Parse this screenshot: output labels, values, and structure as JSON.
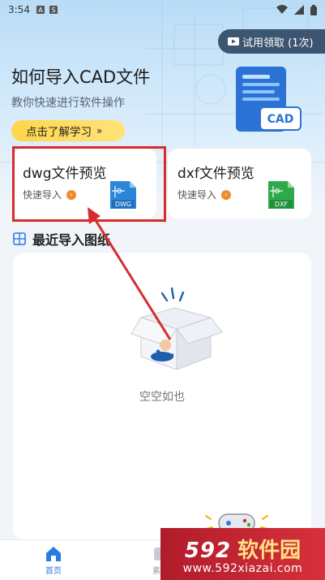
{
  "status_bar": {
    "time": "3:54"
  },
  "hero": {
    "trial_button": "试用领取 (1次)",
    "title": "如何导入CAD文件",
    "subtitle": "教你快速进行软件操作",
    "learn_button": "点击了解学习",
    "learn_arrows": "»",
    "cad_badge": "CAD"
  },
  "cards": [
    {
      "title": "dwg文件预览",
      "action": "快速导入",
      "file_label": "DWG",
      "icon": "dwg-file-icon",
      "color": "#2b86d8"
    },
    {
      "title": "dxf文件预览",
      "action": "快速导入",
      "file_label": "DXF",
      "icon": "dxf-file-icon",
      "color": "#2faa4b"
    }
  ],
  "recent": {
    "title": "最近导入图纸",
    "empty_text": "空空如也"
  },
  "tabbar": {
    "home_label": "首页",
    "material_label": "素材"
  },
  "watermark": {
    "number": "592",
    "name": "软件园",
    "url": "www.592xiazai.com"
  },
  "colors": {
    "accent": "#2b7be5",
    "highlight": "#d62d2d",
    "learn_button": "#ffd54a",
    "trial_button": "#3d5570"
  }
}
